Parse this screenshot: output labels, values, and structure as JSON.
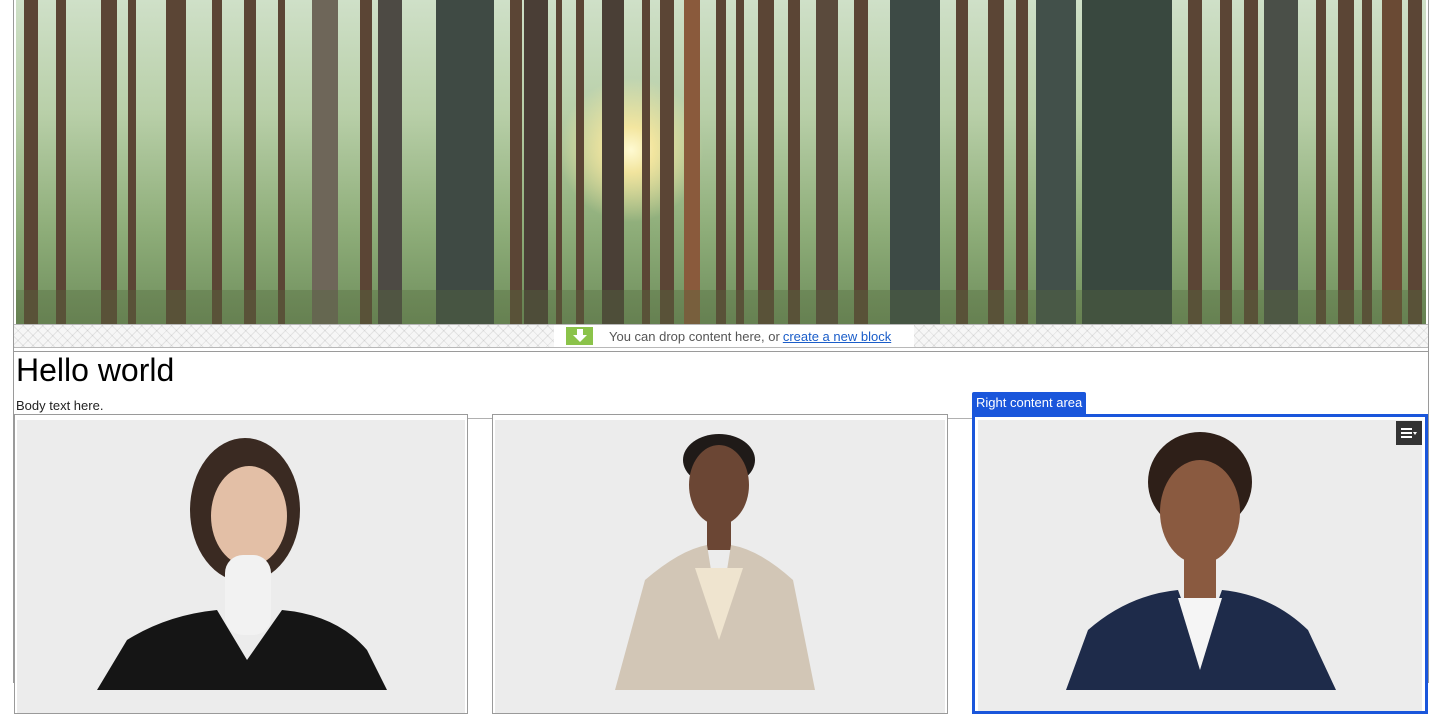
{
  "dropzone": {
    "text": "You can drop content here, or",
    "link": "create a new block",
    "icon": "download-arrow-icon"
  },
  "content": {
    "title": "Hello world",
    "body": "Body text here."
  },
  "right_area": {
    "label": "Right content area",
    "menu_icon": "hamburger-menu-icon"
  },
  "colors": {
    "accent": "#1a56db",
    "drop_icon_bg": "#8bc34a",
    "link": "#1a5dc9"
  }
}
